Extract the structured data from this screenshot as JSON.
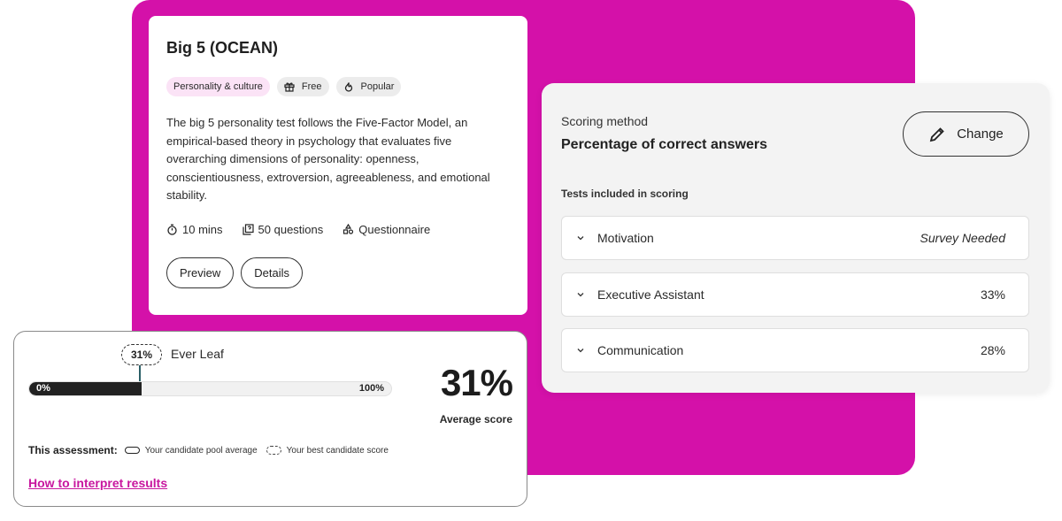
{
  "theme": {
    "accent": "#d411a9",
    "link": "#c8179f",
    "chip_pink": "#fbe3f6"
  },
  "test_card": {
    "title": "Big 5 (OCEAN)",
    "chips": [
      {
        "label": "Personality & culture",
        "icon": "none"
      },
      {
        "label": "Free",
        "icon": "gift-icon"
      },
      {
        "label": "Popular",
        "icon": "flame-icon"
      }
    ],
    "description": "The big 5 personality test follows the Five-Factor Model, an empirical-based theory in psychology that evaluates five overarching dimensions of personality: openness, conscientiousness, extroversion, agreeableness, and emotional stability.",
    "meta": [
      {
        "label": "10 mins",
        "icon": "stopwatch-icon"
      },
      {
        "label": "50 questions",
        "icon": "questions-icon"
      },
      {
        "label": "Questionnaire",
        "icon": "shapes-icon"
      }
    ],
    "buttons": {
      "preview": "Preview",
      "details": "Details"
    }
  },
  "score_card": {
    "best_score_label": "31%",
    "best_candidate_name": "Ever Leaf",
    "bar": {
      "min_label": "0%",
      "max_label": "100%",
      "average_percent": 31,
      "best_percent": 31
    },
    "average_value": "31%",
    "average_label": "Average score",
    "legend": {
      "title": "This assessment:",
      "pool_average": "Your candidate pool average",
      "best_candidate": "Your best candidate score"
    },
    "link": "How to interpret results"
  },
  "scoring": {
    "label": "Scoring method",
    "value": "Percentage of correct answers",
    "change_button": "Change",
    "tests_heading": "Tests included in scoring",
    "tests": [
      {
        "name": "Motivation",
        "value": "Survey Needed",
        "italic": true
      },
      {
        "name": "Executive Assistant",
        "value": "33%",
        "italic": false
      },
      {
        "name": "Communication",
        "value": "28%",
        "italic": false
      }
    ]
  }
}
